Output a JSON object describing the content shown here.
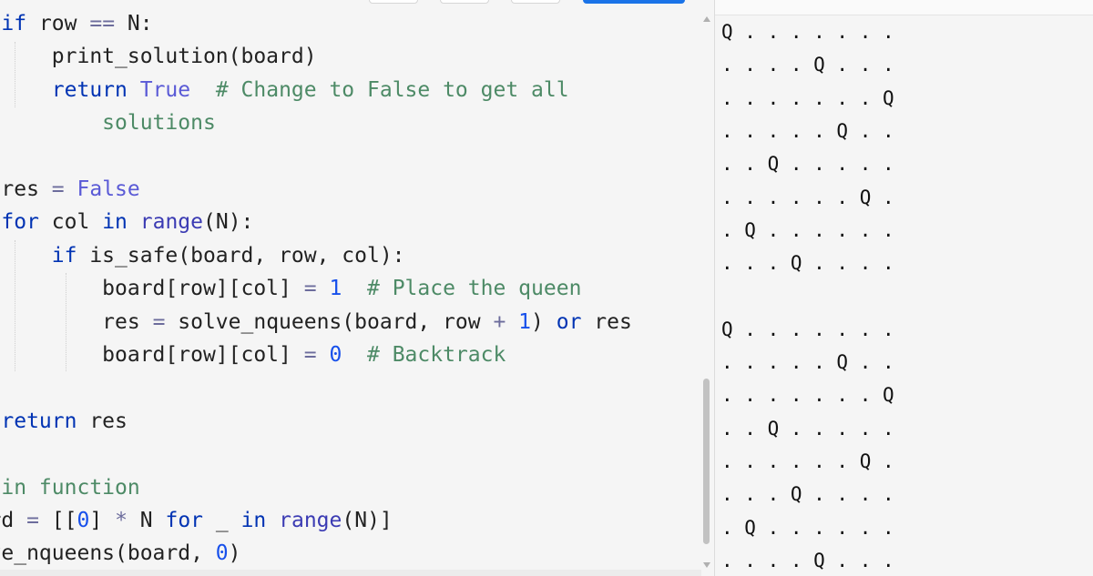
{
  "editor": {
    "code_lines": [
      [
        {
          "t": "    ",
          "c": ""
        },
        {
          "t": "if",
          "c": "kw"
        },
        {
          "t": " row ",
          "c": ""
        },
        {
          "t": "==",
          "c": "op"
        },
        {
          "t": " N:",
          "c": ""
        }
      ],
      [
        {
          "t": "        print_solution(board)",
          "c": ""
        }
      ],
      [
        {
          "t": "        ",
          "c": ""
        },
        {
          "t": "return",
          "c": "kw"
        },
        {
          "t": " ",
          "c": ""
        },
        {
          "t": "True",
          "c": "cn"
        },
        {
          "t": "  ",
          "c": ""
        },
        {
          "t": "# Change to False to get all",
          "c": "cm"
        }
      ],
      [
        {
          "t": "            ",
          "c": ""
        },
        {
          "t": "solutions",
          "c": "cm"
        }
      ],
      [],
      [
        {
          "t": "    res ",
          "c": ""
        },
        {
          "t": "=",
          "c": "op"
        },
        {
          "t": " ",
          "c": ""
        },
        {
          "t": "False",
          "c": "cn"
        }
      ],
      [
        {
          "t": "    ",
          "c": ""
        },
        {
          "t": "for",
          "c": "kw"
        },
        {
          "t": " col ",
          "c": ""
        },
        {
          "t": "in",
          "c": "kw"
        },
        {
          "t": " ",
          "c": ""
        },
        {
          "t": "range",
          "c": "bi"
        },
        {
          "t": "(N):",
          "c": ""
        }
      ],
      [
        {
          "t": "        ",
          "c": ""
        },
        {
          "t": "if",
          "c": "kw"
        },
        {
          "t": " is_safe(board, row, col):",
          "c": ""
        }
      ],
      [
        {
          "t": "            board[row][col] ",
          "c": ""
        },
        {
          "t": "=",
          "c": "op"
        },
        {
          "t": " ",
          "c": ""
        },
        {
          "t": "1",
          "c": "num"
        },
        {
          "t": "  ",
          "c": ""
        },
        {
          "t": "# Place the queen",
          "c": "cm"
        }
      ],
      [
        {
          "t": "            res ",
          "c": ""
        },
        {
          "t": "=",
          "c": "op"
        },
        {
          "t": " solve_nqueens(board, row ",
          "c": ""
        },
        {
          "t": "+",
          "c": "op"
        },
        {
          "t": " ",
          "c": ""
        },
        {
          "t": "1",
          "c": "num"
        },
        {
          "t": ") ",
          "c": ""
        },
        {
          "t": "or",
          "c": "kw"
        },
        {
          "t": " res",
          "c": ""
        }
      ],
      [
        {
          "t": "            board[row][col] ",
          "c": ""
        },
        {
          "t": "=",
          "c": "op"
        },
        {
          "t": " ",
          "c": ""
        },
        {
          "t": "0",
          "c": "num"
        },
        {
          "t": "  ",
          "c": ""
        },
        {
          "t": "# Backtrack",
          "c": "cm"
        }
      ],
      [],
      [
        {
          "t": "    ",
          "c": ""
        },
        {
          "t": "return",
          "c": "kw"
        },
        {
          "t": " res",
          "c": ""
        }
      ],
      [],
      [
        {
          "t": "# Main function",
          "c": "cm"
        }
      ],
      [
        {
          "t": "board ",
          "c": ""
        },
        {
          "t": "=",
          "c": "op"
        },
        {
          "t": " [[",
          "c": ""
        },
        {
          "t": "0",
          "c": "num"
        },
        {
          "t": "] ",
          "c": ""
        },
        {
          "t": "*",
          "c": "op"
        },
        {
          "t": " N ",
          "c": ""
        },
        {
          "t": "for",
          "c": "kw"
        },
        {
          "t": " _ ",
          "c": ""
        },
        {
          "t": "in",
          "c": "kw"
        },
        {
          "t": " ",
          "c": ""
        },
        {
          "t": "range",
          "c": "bi"
        },
        {
          "t": "(N)]",
          "c": ""
        }
      ],
      [
        {
          "t": "solve_nqueens(board, ",
          "c": ""
        },
        {
          "t": "0",
          "c": "num"
        },
        {
          "t": ")",
          "c": ""
        }
      ]
    ]
  },
  "output": {
    "lines": [
      "Q . . . . . . .",
      ". . . . Q . . .",
      ". . . . . . . Q",
      ". . . . . Q . .",
      ". . Q . . . . .",
      ". . . . . . Q .",
      ". Q . . . . . .",
      ". . . Q . . . .",
      "",
      "Q . . . . . . .",
      ". . . . . Q . .",
      ". . . . . . . Q",
      ". . Q . . . . .",
      ". . . . . . Q .",
      ". . . Q . . . .",
      ". Q . . . . . .",
      ". . . . Q . . ."
    ]
  },
  "colors": {
    "keyword": "#0033b3",
    "comment": "#4d8a66",
    "number": "#1750eb",
    "constant": "#5a5ad6",
    "accent": "#1a73e8"
  }
}
